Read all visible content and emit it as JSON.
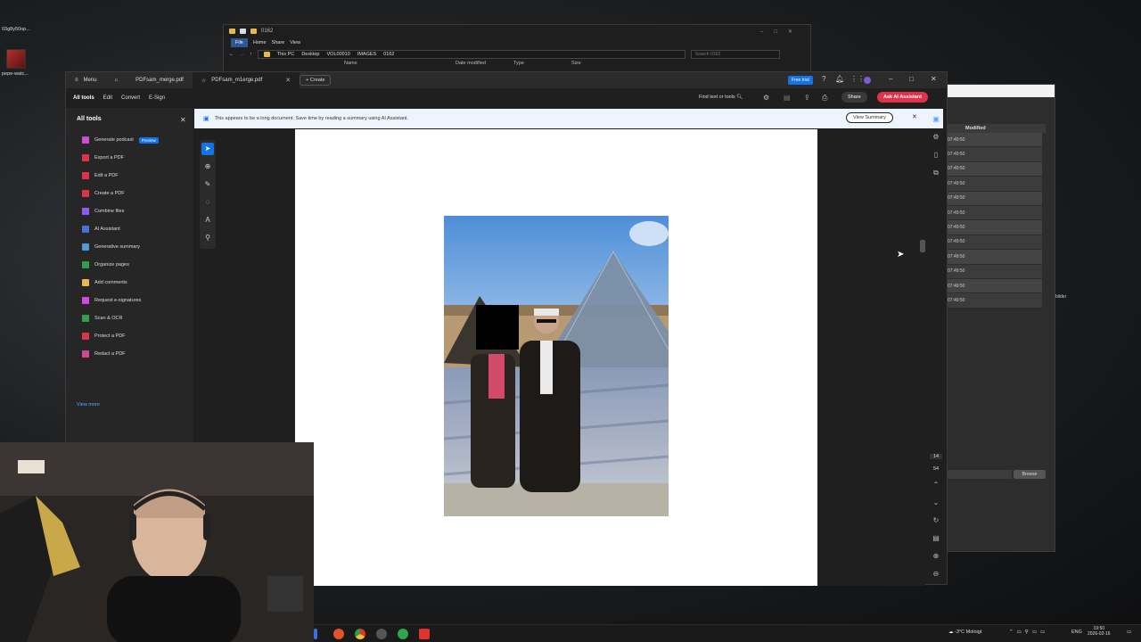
{
  "desktop": {
    "icons": [
      {
        "label": "03g8y50op..."
      },
      {
        "label": "pepe-watc..."
      }
    ]
  },
  "explorer": {
    "title": "0162",
    "ribbon": [
      "File",
      "Home",
      "Share",
      "View"
    ],
    "breadcrumb": [
      "This PC",
      "Desktop",
      "VOL00010",
      "IMAGES",
      "0162"
    ],
    "search_placeholder": "Search 0162",
    "columns": [
      "Name",
      "Date modified",
      "Type",
      "Size"
    ]
  },
  "acrobat": {
    "menu_label": "Menu",
    "tabs": [
      {
        "label": "PDFsam_merge.pdf"
      },
      {
        "label": "PDFsam_m1erge.pdf"
      }
    ],
    "create_label": "Create",
    "free_trial_label": "Free trial",
    "toolbar": {
      "items": [
        "All tools",
        "Edit",
        "Convert",
        "E-Sign"
      ],
      "find_label": "Find text or tools",
      "share_label": "Share",
      "ai_label": "Ask AI Assistant"
    },
    "all_tools": {
      "title": "All tools",
      "items": [
        {
          "label": "Generate podcast",
          "color": "#d14bd9",
          "badge": "Preview"
        },
        {
          "label": "Export a PDF",
          "color": "#e0334b"
        },
        {
          "label": "Edit a PDF",
          "color": "#e0334b"
        },
        {
          "label": "Create a PDF",
          "color": "#e0334b"
        },
        {
          "label": "Combine files",
          "color": "#8b5cf6"
        },
        {
          "label": "AI Assistant",
          "color": "#4b6fd9"
        },
        {
          "label": "Generative summary",
          "color": "#4b9ad9"
        },
        {
          "label": "Organize pages",
          "color": "#30a04a"
        },
        {
          "label": "Add comments",
          "color": "#e6b84d"
        },
        {
          "label": "Request e-signatures",
          "color": "#d14bd9"
        },
        {
          "label": "Scan & OCR",
          "color": "#30a04a"
        },
        {
          "label": "Protect a PDF",
          "color": "#e0334b"
        },
        {
          "label": "Redact a PDF",
          "color": "#d14b8b"
        }
      ],
      "view_more": "View more"
    },
    "banner": {
      "text": "This appears to be a long document. Save time by reading a summary using AI Assistant.",
      "button": "View Summary"
    },
    "page_numbers": [
      "14",
      "54"
    ]
  },
  "pdfsam": {
    "column_header": "Modified",
    "rows": [
      "07:49:50",
      "07:49:50",
      "07:49:50",
      "07:49:50",
      "07:49:50",
      "07:49:50",
      "07:49:50",
      "07:49:50",
      "07:49:50",
      "07:49:50",
      "07:49:50",
      "07:49:50"
    ],
    "browse_label": "Browse",
    "side_label": "bilder"
  },
  "taskbar": {
    "weather": "-3°C Molnigt",
    "language": "ENG",
    "time": "19:50",
    "date": "2026-02-16"
  },
  "colors": {
    "accent": "#1473e6",
    "ai_button": "#e0334b",
    "banner_bg": "#eef4fd"
  }
}
